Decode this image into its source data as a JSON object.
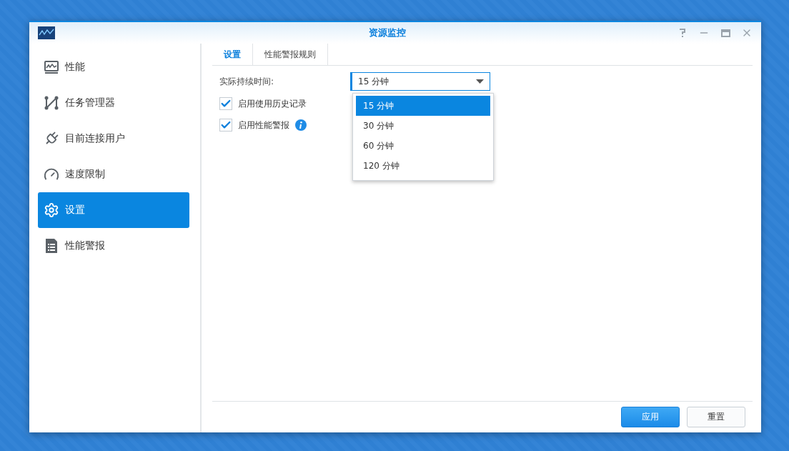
{
  "window": {
    "title": "资源监控"
  },
  "sidebar": {
    "items": [
      {
        "label": "性能",
        "kind": "performance",
        "selected": false
      },
      {
        "label": "任务管理器",
        "kind": "tasks",
        "selected": false
      },
      {
        "label": "目前连接用户",
        "kind": "plug",
        "selected": false
      },
      {
        "label": "速度限制",
        "kind": "gauge",
        "selected": false
      },
      {
        "label": "设置",
        "kind": "settings",
        "selected": true
      },
      {
        "label": "性能警报",
        "kind": "list",
        "selected": false
      }
    ]
  },
  "tabs": [
    {
      "label": "设置",
      "selected": true
    },
    {
      "label": "性能警报规则",
      "selected": false
    }
  ],
  "duration": {
    "label": "实际持续时间:",
    "value": "15 分钟",
    "expanded": true,
    "options": [
      {
        "label": "15 分钟",
        "selected": true
      },
      {
        "label": "30 分钟",
        "selected": false
      },
      {
        "label": "60 分钟",
        "selected": false
      },
      {
        "label": "120 分钟",
        "selected": false
      }
    ]
  },
  "checkboxes": [
    {
      "label": "启用使用历史记录",
      "checked": true,
      "info": false
    },
    {
      "label": "启用性能警报",
      "checked": true,
      "info": true
    }
  ],
  "buttons": [
    {
      "label": "应用",
      "kind": "primary"
    },
    {
      "label": "重置",
      "kind": "secondary"
    }
  ]
}
